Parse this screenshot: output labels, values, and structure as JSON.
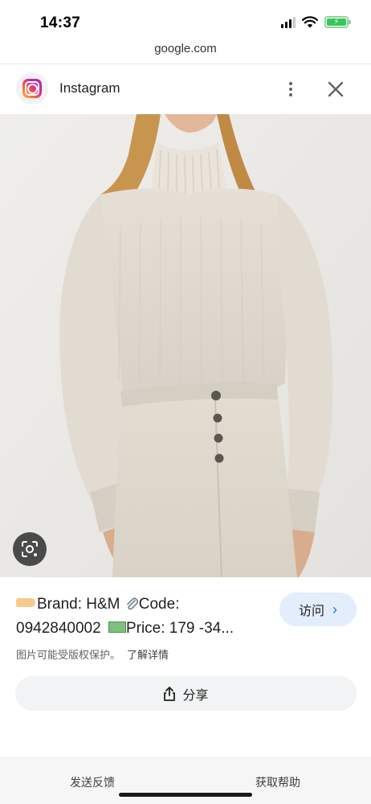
{
  "status_bar": {
    "time": "14:37"
  },
  "browser": {
    "url": "google.com"
  },
  "header": {
    "title": "Instagram",
    "app_icon": "instagram-logo",
    "menu_icon": "more-vertical-icon",
    "close_icon": "close-icon"
  },
  "image": {
    "alt": "Woman wearing a cream high-neck ribbed sweater with balloon sleeves and cream button-fly jeans",
    "lens_icon": "google-lens-icon"
  },
  "description": {
    "brand_text": "Brand: H&M ",
    "code_text": "Code:",
    "code_value": "0942840002 ",
    "price_text": "Price: 179 -34..."
  },
  "visit_button": {
    "label": "访问"
  },
  "copyright": {
    "notice": "图片可能受版权保护。",
    "learn_more": "了解详情"
  },
  "share_button": {
    "label": "分享"
  },
  "footer": {
    "feedback": "发送反馈",
    "help": "获取帮助"
  },
  "colors": {
    "accent": "#1a73e8",
    "visit_bg": "#e3edfb",
    "share_bg": "#f1f3f4",
    "battery": "#34c759"
  }
}
